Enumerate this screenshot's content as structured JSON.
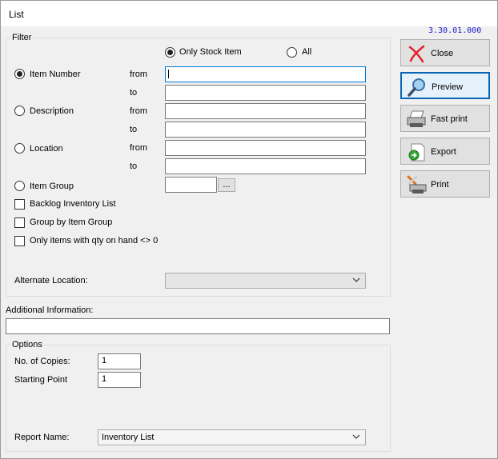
{
  "window": {
    "title": "List",
    "version": "3.30.01.000"
  },
  "filter": {
    "title": "Filter",
    "stock_options": [
      {
        "label": "Only Stock Item",
        "selected": true
      },
      {
        "label": "All",
        "selected": false
      }
    ],
    "from_label": "from",
    "to_label": "to",
    "ranges": [
      {
        "label": "Item Number",
        "selected": true,
        "from": "",
        "to": ""
      },
      {
        "label": "Description",
        "selected": false,
        "from": "",
        "to": ""
      },
      {
        "label": "Location",
        "selected": false,
        "from": "",
        "to": ""
      }
    ],
    "item_group": {
      "label": "Item Group",
      "selected": false,
      "value": "",
      "browse_label": "..."
    },
    "checkboxes": [
      {
        "label": "Backlog Inventory List",
        "checked": false
      },
      {
        "label": "Group by Item Group",
        "checked": false
      },
      {
        "label": "Only items with qty on hand <> 0",
        "checked": false
      }
    ],
    "alternate_location": {
      "label": "Alternate Location:",
      "value": ""
    }
  },
  "additional_info": {
    "label": "Additional Information:",
    "value": ""
  },
  "options": {
    "title": "Options",
    "copies": {
      "label": "No. of Copies:",
      "value": "1"
    },
    "starting_point": {
      "label": "Starting Point",
      "value": "1"
    },
    "report_name": {
      "label": "Report Name:",
      "value": "Inventory List"
    }
  },
  "buttons": {
    "close": "Close",
    "preview": "Preview",
    "fast_print": "Fast print",
    "export": "Export",
    "print": "Print"
  }
}
